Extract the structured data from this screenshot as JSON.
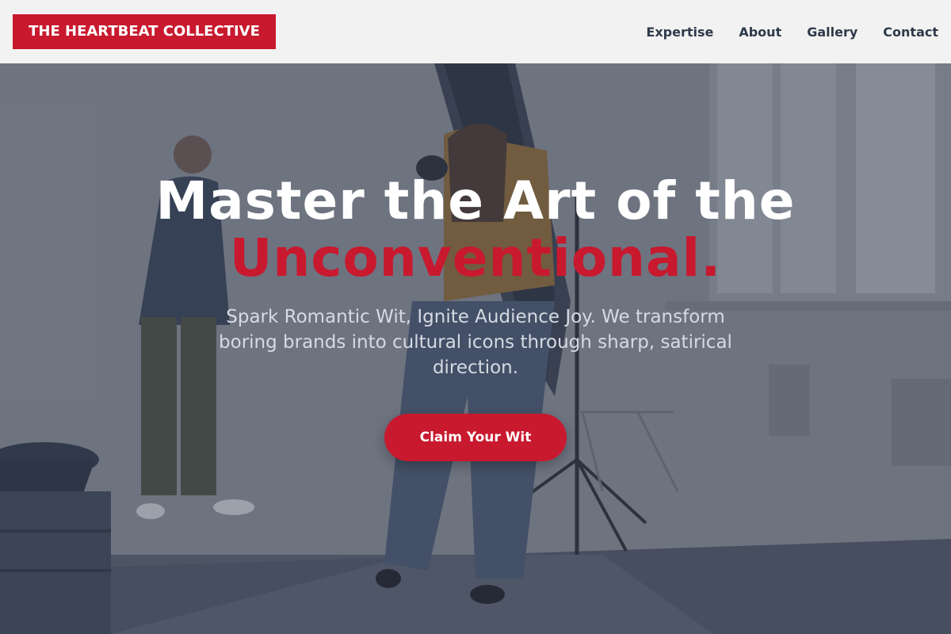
{
  "header": {
    "logo_text": "THE HEARTBEAT COLLECTIVE",
    "nav": [
      {
        "label": "Expertise"
      },
      {
        "label": "About"
      },
      {
        "label": "Gallery"
      },
      {
        "label": "Contact"
      }
    ]
  },
  "hero": {
    "headline_line1": "Master the Art of the",
    "headline_line2": "Unconventional.",
    "subtext": "Spark Romantic Wit, Ignite Audience Joy. We transform boring brands into cultural icons through sharp, satirical direction.",
    "cta_label": "Claim Your Wit"
  },
  "colors": {
    "brand_red": "#c8192e",
    "header_bg": "#f2f2f2",
    "nav_text": "#2e3a4a"
  }
}
